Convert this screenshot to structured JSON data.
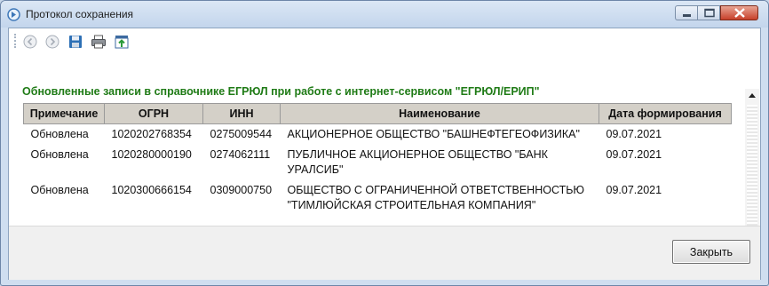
{
  "window": {
    "title": "Протокол сохранения",
    "icon": "app-icon",
    "controls": [
      "minimize-icon",
      "maximize-icon",
      "close-icon"
    ]
  },
  "toolbar": {
    "buttons": [
      "back-icon",
      "forward-icon",
      "save-icon",
      "print-icon",
      "export-icon"
    ]
  },
  "report": {
    "heading": "Обновленные записи в справочнике ЕГРЮЛ при работе с интернет-сервисом \"ЕГРЮЛ/ЕРИП\"",
    "heading_color": "#1f7b16",
    "columns": [
      "Примечание",
      "ОГРН",
      "ИНН",
      "Наименование",
      "Дата формирования"
    ],
    "rows": [
      {
        "note": "Обновлена",
        "ogrn": "1020202768354",
        "inn": "0275009544",
        "name": "АКЦИОНЕРНОЕ ОБЩЕСТВО \"БАШНЕФТЕГЕОФИЗИКА\"",
        "date": "09.07.2021"
      },
      {
        "note": "Обновлена",
        "ogrn": "1020280000190",
        "inn": "0274062111",
        "name": "ПУБЛИЧНОЕ АКЦИОНЕРНОЕ ОБЩЕСТВО \"БАНК УРАЛСИБ\"",
        "date": "09.07.2021"
      },
      {
        "note": "Обновлена",
        "ogrn": "1020300666154",
        "inn": "0309000750",
        "name": "ОБЩЕСТВО С ОГРАНИЧЕННОЙ ОТВЕТСТВЕННОСТЬЮ \"ТИМЛЮЙСКАЯ СТРОИТЕЛЬНАЯ КОМПАНИЯ\"",
        "date": "09.07.2021"
      }
    ]
  },
  "footer": {
    "close_label": "Закрыть"
  }
}
